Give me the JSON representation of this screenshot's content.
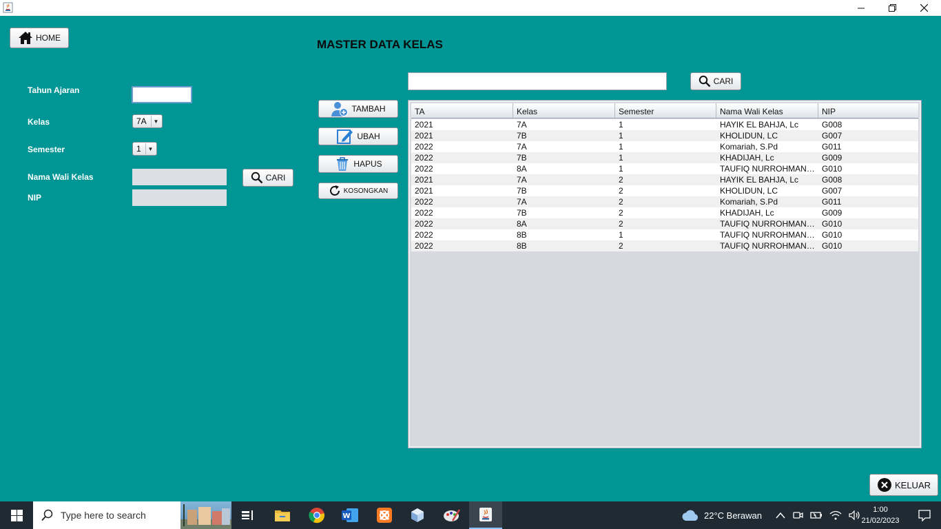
{
  "window": {
    "icon": "java-icon",
    "controls": {
      "minimize": "minimize-icon",
      "maximize": "restore-icon",
      "close": "close-icon"
    }
  },
  "header": {
    "home_label": "HOME",
    "page_title": "MASTER DATA KELAS"
  },
  "form": {
    "tahun_ajaran_label": "Tahun Ajaran",
    "tahun_ajaran_value": "",
    "kelas_label": "Kelas",
    "kelas_value": "7A",
    "semester_label": "Semester",
    "semester_value": "1",
    "wali_label": "Nama Wali Kelas",
    "wali_value": "",
    "nip_label": "NIP",
    "nip_value": "",
    "cari_label": "CARI"
  },
  "actions": {
    "tambah": "TAMBAH",
    "ubah": "UBAH",
    "hapus": "HAPUS",
    "kosongkan": "KOSONGKAN"
  },
  "search": {
    "value": "",
    "cari_label": "CARI"
  },
  "table": {
    "columns": [
      "TA",
      "Kelas",
      "Semester",
      "Nama Wali Kelas",
      "NIP"
    ],
    "rows": [
      [
        "2021",
        "7A",
        "1",
        "HAYIK EL BAHJA, Lc",
        "G008"
      ],
      [
        "2021",
        "7B",
        "1",
        "KHOLIDUN, LC",
        "G007"
      ],
      [
        "2022",
        "7A",
        "1",
        "Komariah, S.Pd",
        "G011"
      ],
      [
        "2022",
        "7B",
        "1",
        "KHADIJAH, Lc",
        "G009"
      ],
      [
        "2022",
        "8A",
        "1",
        "TAUFIQ NURROHMAN,...",
        "G010"
      ],
      [
        "2021",
        "7A",
        "2",
        "HAYIK EL BAHJA, Lc",
        "G008"
      ],
      [
        "2021",
        "7B",
        "2",
        "KHOLIDUN, LC",
        "G007"
      ],
      [
        "2022",
        "7A",
        "2",
        "Komariah, S.Pd",
        "G011"
      ],
      [
        "2022",
        "7B",
        "2",
        "KHADIJAH, Lc",
        "G009"
      ],
      [
        "2022",
        "8A",
        "2",
        "TAUFIQ NURROHMAN,...",
        "G010"
      ],
      [
        "2022",
        "8B",
        "1",
        "TAUFIQ NURROHMAN,...",
        "G010"
      ],
      [
        "2022",
        "8B",
        "2",
        "TAUFIQ NURROHMAN,...",
        "G010"
      ]
    ]
  },
  "footer": {
    "keluar_label": "KELUAR"
  },
  "taskbar": {
    "search_placeholder": "Type here to search",
    "weather": "22°C  Berawan",
    "time": "1:00",
    "date": "21/02/2023",
    "apps": [
      "task-view-icon",
      "file-explorer-icon",
      "chrome-icon",
      "word-icon",
      "xampp-icon",
      "virtualbox-icon",
      "paint-icon",
      "java-icon"
    ]
  }
}
